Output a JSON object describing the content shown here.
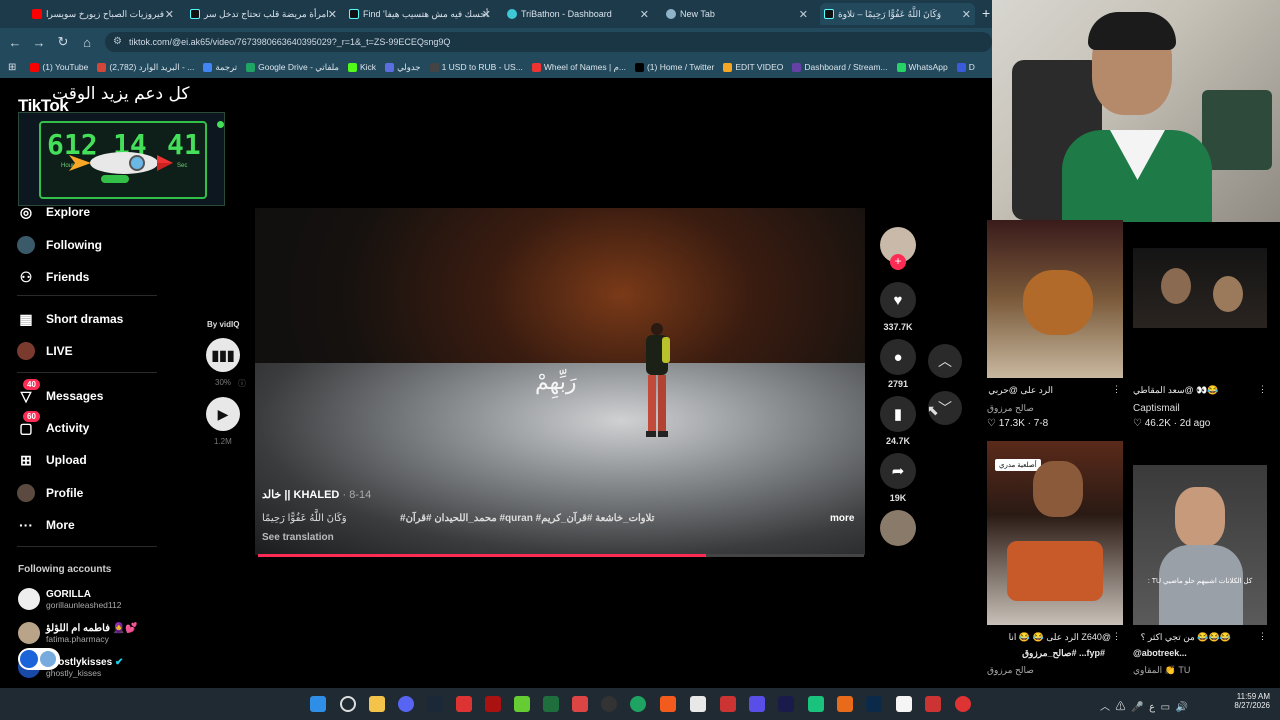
{
  "tabs": [
    {
      "label": "فيروزيات الصباح زيورخ سويسرا"
    },
    {
      "label": "امرأة مريضة قلب تحتاج تدخل سر"
    },
    {
      "label": "Find 'أحسك فيه مش هتسيب هيفا"
    },
    {
      "label": "TriBathon - Dashboard"
    },
    {
      "label": "New Tab"
    },
    {
      "label": "وَكَانَ اللَّهُ عَفُوًّا رَحِيمًا – تلاوة"
    }
  ],
  "address": {
    "url": "tiktok.com/@ei.ak65/video/7673980663640395029?_r=1&_t=ZS-99ECEQsng9Q"
  },
  "bookmarks": [
    {
      "label": "(1) YouTube",
      "color": "#ff0000"
    },
    {
      "label": "(2,782) البريد الوارد - ...",
      "color": "#d44638"
    },
    {
      "label": "ترجمة",
      "color": "#4285f4"
    },
    {
      "label": "Google Drive - ملفاتي",
      "color": "#1fa463"
    },
    {
      "label": "Kick",
      "color": "#53fc18"
    },
    {
      "label": "جدولي",
      "color": "#5b6ee1"
    },
    {
      "label": "1 USD to RUB - US...",
      "color": "#444"
    },
    {
      "label": "Wheel of Names | م...",
      "color": "#e33"
    },
    {
      "label": "(1) Home / Twitter",
      "color": "#000"
    },
    {
      "label": "EDIT VIDEO",
      "color": "#f5a623"
    },
    {
      "label": "Dashboard / Stream...",
      "color": "#6441a5"
    },
    {
      "label": "WhatsApp",
      "color": "#25d366"
    },
    {
      "label": "D",
      "color": "#3b5bdb"
    }
  ],
  "overlay": {
    "support_text": "كل دعم يزيد الوقت",
    "timer": {
      "h": "612",
      "m": "14",
      "s": "41",
      "hlabel": "Hour",
      "slabel": "Sec"
    }
  },
  "sidebar": {
    "logo": "TikTok",
    "items": [
      {
        "label": "Explore",
        "icon": "compass-icon"
      },
      {
        "label": "Following",
        "icon": "following-icon"
      },
      {
        "label": "Friends",
        "icon": "friends-icon"
      },
      {
        "label": "Short dramas",
        "icon": "film-icon"
      },
      {
        "label": "LIVE",
        "icon": "live-icon"
      },
      {
        "label": "Messages",
        "badge": "40",
        "icon": "messages-icon"
      },
      {
        "label": "Activity",
        "badge": "60",
        "icon": "activity-icon"
      },
      {
        "label": "Upload",
        "icon": "upload-icon"
      },
      {
        "label": "Profile",
        "icon": "profile-icon"
      },
      {
        "label": "More",
        "icon": "more-icon"
      }
    ],
    "following_header": "Following accounts",
    "accounts": [
      {
        "name": "GORILLA",
        "handle": "gorillaunleashed112"
      },
      {
        "name": "فاطمه ام اللؤلؤ 🧕💕",
        "handle": "fatima.pharmacy"
      },
      {
        "name": "ghostlykisses",
        "handle": "ghostly_kisses"
      }
    ]
  },
  "vidiq": {
    "by": "By vidIQ",
    "percent": "30%",
    "views": "1.2M"
  },
  "video": {
    "arabic_overlay": "رَبِّهِمْ",
    "author": "خالد || KHALED",
    "date": "8-14",
    "desc": "#محمد_اللحيدان #قرآن #quran #تلاوات_خاشعة #قرآن_كريم",
    "desc_start": "وَكَانَ اللَّهُ عَفُوًّا رَحِيمًا",
    "more": "more",
    "translation": "See translation",
    "progress": 0.74
  },
  "actions": {
    "likes": "337.7K",
    "comments": "2791",
    "saves": "24.7K",
    "shares": "19K"
  },
  "feed": [
    {
      "caption": "الرد على @حربي",
      "author": "صالح مرزوق",
      "likes": "17.3K",
      "date": "7-8"
    },
    {
      "caption": "سعد المقاطي@ 👀😂",
      "author": "Captismail",
      "likes": "46.2K",
      "date": "2d ago"
    },
    {
      "caption": "@Z640 الرد على 😂 😂 انا",
      "caption2": "#fyp... #صالح_مرزوق",
      "author": "صالح مرزوق",
      "badge": "أصلعية مدري"
    },
    {
      "caption": "😂😂😂 من تجي اكثر ؟",
      "caption2": "@abotreek...",
      "author": "المقاوي 👏 TU",
      "overlay": "كل الكلانات اشبيهم حلو ماضيي TU :"
    }
  ],
  "taskbar": {
    "time": "11:59 AM",
    "date": "8/27/2026"
  }
}
